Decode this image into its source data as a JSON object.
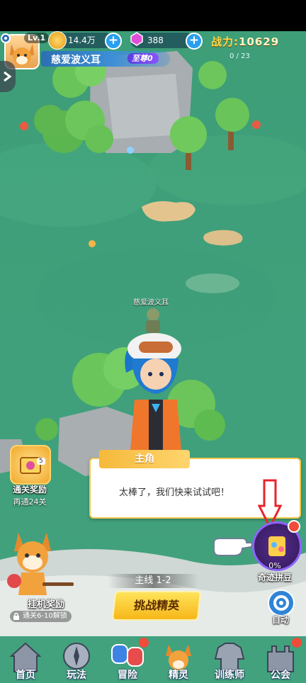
{
  "player": {
    "level": "Lv.1",
    "name": "慈爱波义耳",
    "vip": "至尊0"
  },
  "resources": {
    "coins": "14.4万",
    "gems": "388"
  },
  "power": {
    "label": "战力:",
    "value": "10629"
  },
  "progress": "0 / 23",
  "map": {
    "companion_name": "慈爱波义耳"
  },
  "left_widgets": {
    "clear_reward": {
      "label": "通关奖励",
      "sublabel": "再通24关",
      "badge": "5"
    },
    "idle_reward": {
      "label": "挂机奖励",
      "lock_text": "通关6-10解锁"
    }
  },
  "dialog": {
    "speaker": "主角",
    "text": "太棒了，我们快来试试吧！"
  },
  "wonder": {
    "label": "奇迹拼豆",
    "percent": "0%"
  },
  "auto_button": "自动",
  "stage": {
    "mission": "主线 1-2",
    "challenge": "挑战精英"
  },
  "bottom_tabs": [
    {
      "label": "首页",
      "icon": "house-icon"
    },
    {
      "label": "玩法",
      "icon": "compass-icon"
    },
    {
      "label": "冒险",
      "icon": "boxing-glove-icon"
    },
    {
      "label": "精灵",
      "icon": "fox-icon"
    },
    {
      "label": "训练师",
      "icon": "jacket-icon"
    },
    {
      "label": "公会",
      "icon": "castle-icon"
    }
  ],
  "colors": {
    "grass": "#3e9a7a",
    "gold": "#ffd84a",
    "blue_accent": "#2a9ff0",
    "red_arrow": "#e8232a"
  }
}
